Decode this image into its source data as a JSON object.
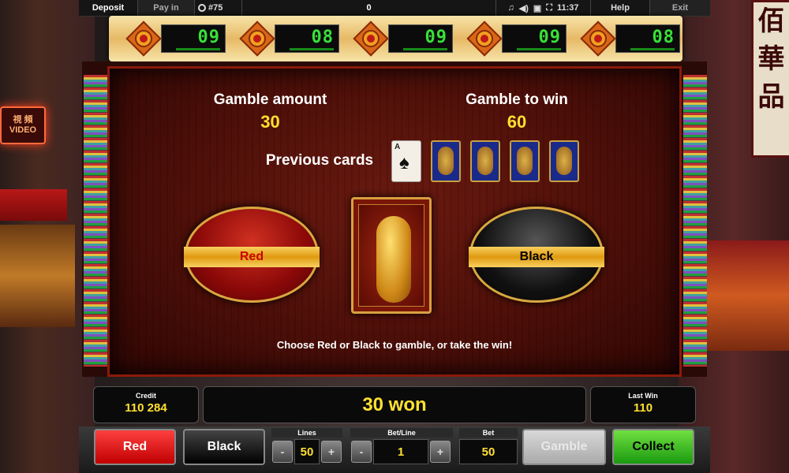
{
  "topbar": {
    "deposit": "Deposit",
    "pay_in": "Pay in",
    "game_number": "#75",
    "center_value": "0",
    "time": "11:37",
    "help": "Help",
    "exit": "Exit"
  },
  "reels": [
    "09",
    "08",
    "09",
    "09",
    "08"
  ],
  "gamble": {
    "amount_label": "Gamble amount",
    "amount_value": "30",
    "to_win_label": "Gamble to win",
    "to_win_value": "60",
    "previous_label": "Previous cards",
    "previous_cards": [
      "ace-of-spades",
      "card-back",
      "card-back",
      "card-back",
      "card-back"
    ],
    "ace_rank": "A",
    "ace_suit": "♠",
    "red_choice": "Red",
    "black_choice": "Black",
    "hint": "Choose Red or Black to gamble, or take the win!"
  },
  "status": {
    "credit_label": "Credit",
    "credit_value": "110 284",
    "message": "30 won",
    "last_win_label": "Last Win",
    "last_win_value": "110"
  },
  "controls": {
    "red": "Red",
    "black": "Black",
    "lines_label": "Lines",
    "lines_value": "50",
    "betline_label": "Bet/Line",
    "betline_value": "1",
    "bet_label": "Bet",
    "bet_value": "50",
    "minus": "-",
    "plus": "+",
    "gamble": "Gamble",
    "collect": "Collect"
  },
  "colors": {
    "value_yellow": "#ffe030",
    "lcd_green": "#38e038",
    "collect_green": "#1a9a10",
    "red_button": "#c00000"
  }
}
